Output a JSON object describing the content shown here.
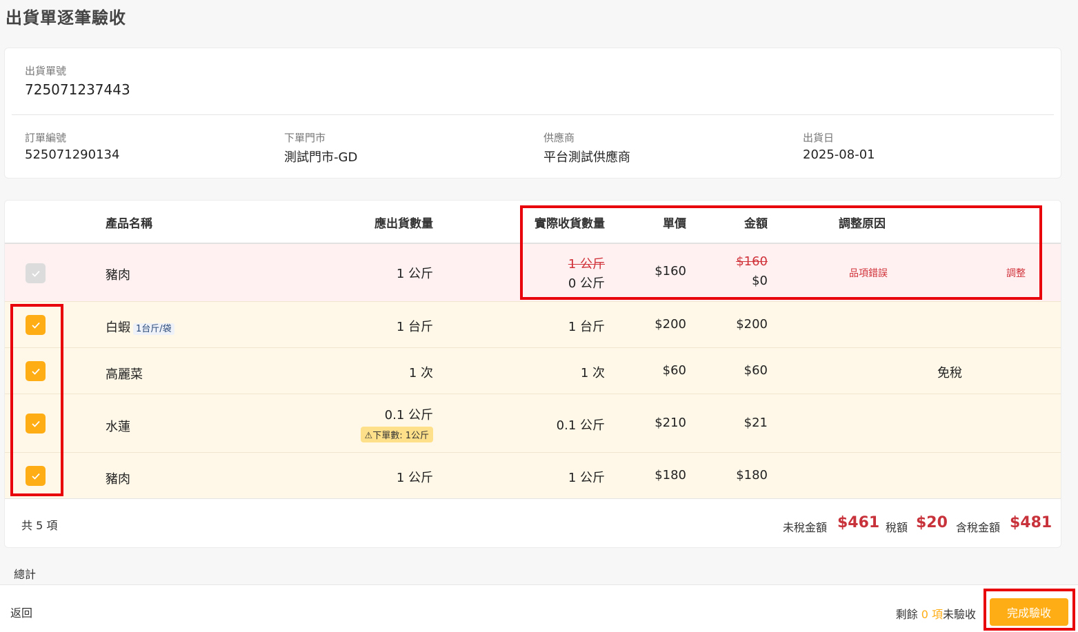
{
  "page": {
    "title": "出貨單逐筆驗收"
  },
  "shipment": {
    "no_label": "出貨單號",
    "no_value": "725071237443",
    "order_label": "訂單編號",
    "order_value": "525071290134",
    "store_label": "下單門市",
    "store_value": "測試門市-GD",
    "supplier_label": "供應商",
    "supplier_value": "平台測試供應商",
    "date_label": "出貨日",
    "date_value": "2025-08-01"
  },
  "table": {
    "headers": {
      "name": "產品名稱",
      "expected_qty": "應出貨數量",
      "actual_qty": "實際收貨數量",
      "price": "單價",
      "amount": "金額",
      "reason": "調整原因"
    },
    "rows": [
      {
        "checked": false,
        "disabled": true,
        "name": "豬肉",
        "expected_qty": "1 公斤",
        "actual_qty_old": "1 公斤",
        "actual_qty": "0 公斤",
        "price": "$160",
        "amount_old": "$160",
        "amount": "$0",
        "reason": "品項錯誤",
        "action": "調整"
      },
      {
        "checked": true,
        "name": "白蝦",
        "unit_tag": "1台斤/袋",
        "expected_qty": "1 台斤",
        "actual_qty": "1 台斤",
        "price": "$200",
        "amount": "$200"
      },
      {
        "checked": true,
        "name": "高麗菜",
        "expected_qty": "1 次",
        "actual_qty": "1 次",
        "price": "$60",
        "amount": "$60",
        "note": "免稅"
      },
      {
        "checked": true,
        "name": "水蓮",
        "expected_qty": "0.1 公斤",
        "warning": "⚠下單數: 1公斤",
        "actual_qty": "0.1 公斤",
        "price": "$210",
        "amount": "$21"
      },
      {
        "checked": true,
        "name": "豬肉",
        "expected_qty": "1 公斤",
        "actual_qty": "1 公斤",
        "price": "$180",
        "amount": "$180"
      }
    ],
    "footer": {
      "count": "共 5 項",
      "pretax_label": "未稅金額",
      "pretax_value": "$461",
      "tax_label": "稅額",
      "tax_value": "$20",
      "total_label": "含稅金額",
      "total_value": "$481"
    }
  },
  "total_section_label": "總計",
  "bottom": {
    "back": "返回",
    "remain_prefix": "剩餘 ",
    "remain_count": "0 項",
    "remain_suffix": "未驗收",
    "complete": "完成驗收"
  },
  "colors": {
    "accent": "#ffad14",
    "danger": "#d0323a",
    "highlight": "#e8000a"
  }
}
